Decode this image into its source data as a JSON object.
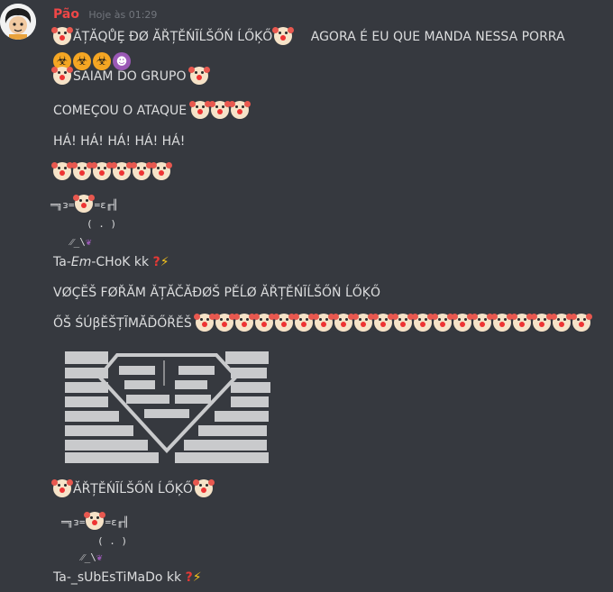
{
  "message": {
    "username": "Pão",
    "timestamp": "Hoje às 01:29",
    "line1_title": "ǍȚĂQŮȨ ĐØ ĂŘȚĚŃĨĹŠŐŃ ĹŐĶŐ",
    "line1_tail": "AGORA É EU QUE MANDA NESSA PORRA",
    "line3": "SAIAM DO GRUPO",
    "line4": "COMEÇOU O ATAQUE",
    "line5": "HÁ! HÁ! HÁ! HÁ! HÁ!",
    "art1_row1_a": "═╗ᴈ=",
    "art1_row1_b": "=ɛ╓╢",
    "art1_row2": "( . )",
    "art1_row3": "⁄⁄_\\",
    "caption1_a": "Ta-",
    "caption1_em": "Em",
    "caption1_b": "-CHoK kk",
    "line_vocs": "VØÇĔŠ FØŘĂM ǍȚĂČĂĐØŠ PĚĹØ ĂŘȚĚŃĨĹŠŐŃ ĹŐĶŐ",
    "line_subest": "ŐŠ ŚÚβĚŠȚĨMĂĎŐŘĚŠ",
    "line_name": "ĂŘȚĚŃĨĹŠŐŃ ĹŐĶŐ",
    "caption2": "Ta-_sUbEsTiMaDo kk"
  },
  "icons": {
    "clown": "clown-face-icon",
    "biohazard": "biohazard-icon",
    "devil": "smiling-devil-icon",
    "eggplant": "eggplant-icon",
    "question": "red-question-mark-icon",
    "bolt": "lightning-bolt-icon"
  },
  "colors": {
    "background": "#36393f",
    "username": "#f04747",
    "text": "#dcddde",
    "timestamp": "#72767d"
  }
}
